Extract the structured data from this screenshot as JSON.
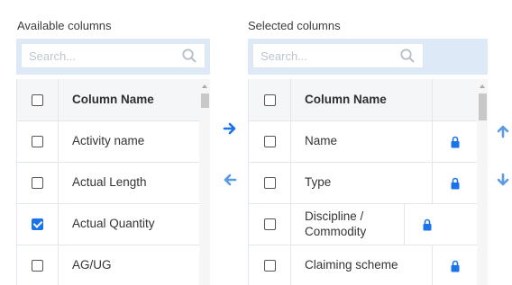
{
  "available": {
    "title": "Available columns",
    "search_placeholder": "Search...",
    "header": "Column Name",
    "rows": [
      {
        "label": "Activity name",
        "checked": false
      },
      {
        "label": "Actual Length",
        "checked": false
      },
      {
        "label": "Actual Quantity",
        "checked": true
      },
      {
        "label": "AG/UG",
        "checked": false
      }
    ]
  },
  "selected": {
    "title": "Selected columns",
    "search_placeholder": "Search...",
    "header": "Column Name",
    "rows": [
      {
        "label": "Name",
        "locked": true
      },
      {
        "label": "Type",
        "locked": true
      },
      {
        "label": "Discipline / Commodity",
        "locked": true
      },
      {
        "label": "Claiming scheme",
        "locked": true
      }
    ]
  },
  "icons": {
    "search": "search-icon",
    "lock": "lock-icon",
    "move_right": "arrow-right-icon",
    "move_left": "arrow-left-icon",
    "move_up": "arrow-up-icon",
    "move_down": "arrow-down-icon"
  },
  "colors": {
    "accent": "#1a73e8",
    "search_bg": "#dde9f6",
    "header_bg": "#f5f6f7"
  }
}
